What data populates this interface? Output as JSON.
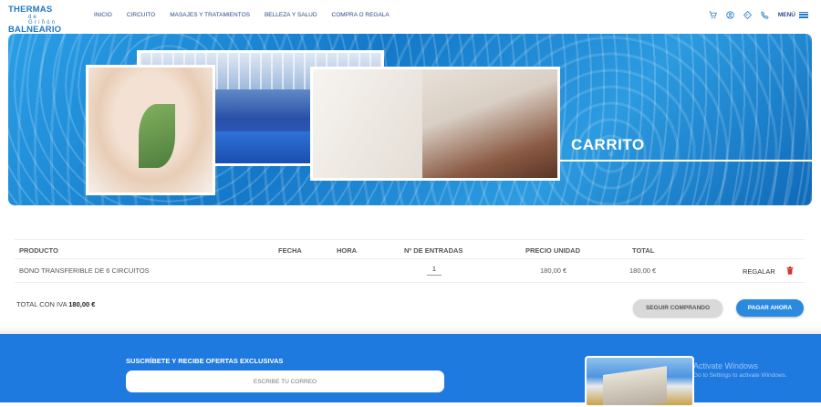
{
  "brand": {
    "line1": "THERMAS",
    "line2": "de Griñón",
    "line3": "BALNEARIO"
  },
  "nav": [
    "INICIO",
    "CIRCUITO",
    "MASAJES Y TRATAMIENTOS",
    "BELLEZA Y SALUD",
    "COMPRA O REGALA"
  ],
  "header": {
    "menu_label": "MENÚ"
  },
  "hero": {
    "title": "CARRITO"
  },
  "cart": {
    "columns": [
      "PRODUCTO",
      "FECHA",
      "HORA",
      "Nº DE ENTRADAS",
      "PRECIO UNIDAD",
      "TOTAL"
    ],
    "rows": [
      {
        "product": "BONO TRANSFERIBLE DE 6 CIRCUITOS",
        "fecha": "",
        "hora": "",
        "qty": "1",
        "price": "180,00 €",
        "total": "180,00 €",
        "gift": "REGALAR"
      }
    ],
    "total_label": "TOTAL CON IVA",
    "total_value": "180,00 €",
    "continue_label": "SEGUIR COMPRANDO",
    "pay_label": "PAGAR AHORA"
  },
  "footer": {
    "subscribe_title": "SUSCRÍBETE Y RECIBE OFERTAS EXCLUSIVAS",
    "email_placeholder": "ESCRIBE TU CORREO"
  },
  "watermark": {
    "line1": "Activate Windows",
    "line2": "Go to Settings to activate Windows."
  },
  "colors": {
    "primary": "#1f7ae0",
    "brand": "#1f78c8",
    "nav_text": "#2a4a8a",
    "delete": "#d9302c"
  },
  "icons": [
    "cart-icon",
    "user-icon",
    "location-icon",
    "phone-icon",
    "menu-icon",
    "trash-icon"
  ]
}
